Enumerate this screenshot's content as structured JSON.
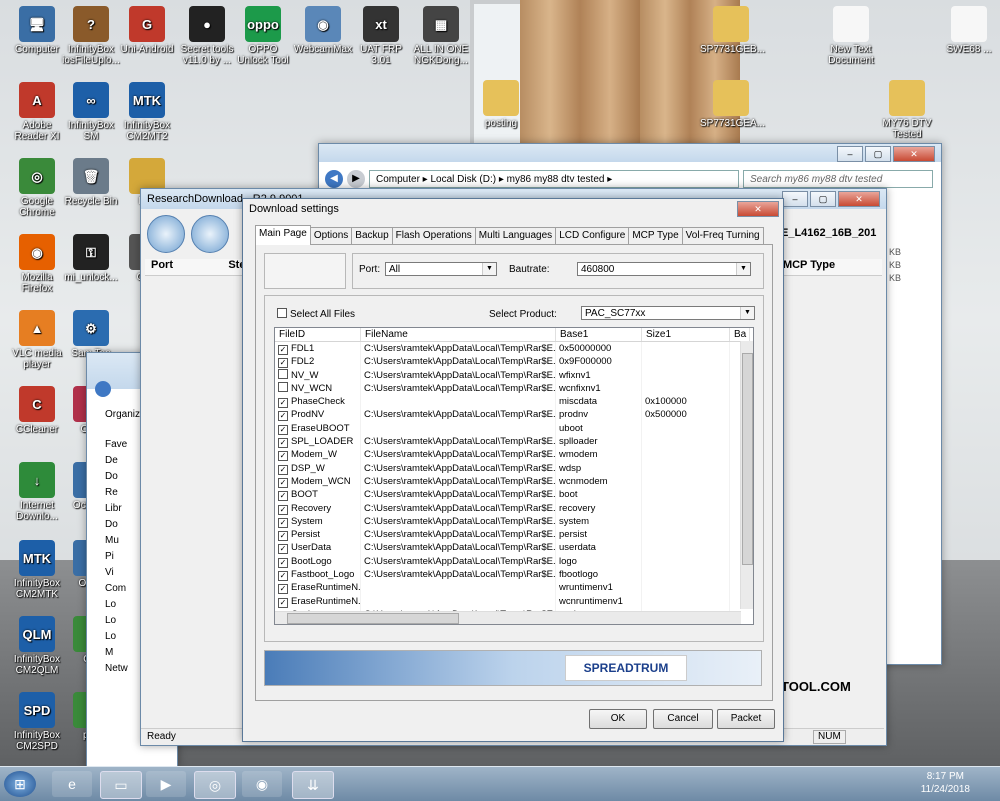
{
  "desktop": {
    "icons": [
      {
        "label": "Computer",
        "color": "#3a6ea5",
        "glyph": "🖥"
      },
      {
        "label": "InfinityBox iosFileUplo...",
        "color": "#8a5a2a",
        "glyph": "?"
      },
      {
        "label": "Uni-Android",
        "color": "#c0392b",
        "glyph": "G"
      },
      {
        "label": "Secret tools v11.0 by ...",
        "color": "#222",
        "glyph": "●"
      },
      {
        "label": "OPPO Unlock Tool",
        "color": "#1c9a4a",
        "glyph": "oppo"
      },
      {
        "label": "WebcamMax",
        "color": "#5a87b8",
        "glyph": "◉"
      },
      {
        "label": "UAT FRP 3.01",
        "color": "#333",
        "glyph": "xt"
      },
      {
        "label": "ALL IN ONE NGKDong...",
        "color": "#444",
        "glyph": "▦"
      },
      {
        "label": "Adobe Reader XI",
        "color": "#c0392b",
        "glyph": "A"
      },
      {
        "label": "InfinityBox SM",
        "color": "#1d5fa8",
        "glyph": "∞"
      },
      {
        "label": "InfinityBox CM2MT2",
        "color": "#1d5fa8",
        "glyph": "MTK"
      },
      {
        "label": "Google Chrome",
        "color": "#3a8a3a",
        "glyph": "◎"
      },
      {
        "label": "Recycle Bin",
        "color": "#6b7b8a",
        "glyph": "🗑"
      },
      {
        "label": "Pos",
        "color": "#d4a83a",
        "glyph": ""
      },
      {
        "label": "Mozilla Firefox",
        "color": "#e66000",
        "glyph": "◉"
      },
      {
        "label": "mi_unlock...",
        "color": "#222",
        "glyph": "⚿"
      },
      {
        "label": "GRT",
        "color": "#555",
        "glyph": ""
      },
      {
        "label": "VLC media player",
        "color": "#e67e22",
        "glyph": "▲"
      },
      {
        "label": "Sam Too",
        "color": "#2b6cb0",
        "glyph": "⚙"
      },
      {
        "label": "CCleaner",
        "color": "#c0392b",
        "glyph": "C"
      },
      {
        "label": "Octo",
        "color": "#b0304a",
        "glyph": "✓"
      },
      {
        "label": "Internet Downlo...",
        "color": "#2e8b3a",
        "glyph": "↓"
      },
      {
        "label": "Octo Sa",
        "color": "#3a6ea5",
        "glyph": ""
      },
      {
        "label": "InfinityBox CM2MTK",
        "color": "#1d5fa8",
        "glyph": "MTK"
      },
      {
        "label": "Oct S",
        "color": "#3a6ea5",
        "glyph": ""
      },
      {
        "label": "InfinityBox CM2QLM",
        "color": "#1d5fa8",
        "glyph": "QLM"
      },
      {
        "label": "Oct",
        "color": "#3a8a3a",
        "glyph": ""
      },
      {
        "label": "InfinityBox CM2SPD",
        "color": "#1d5fa8",
        "glyph": "SPD"
      },
      {
        "label": "pTo",
        "color": "#3a8a3a",
        "glyph": ""
      },
      {
        "label": "SP7731GEB...",
        "color": "#e6c15a",
        "glyph": ""
      },
      {
        "label": "New Text Document",
        "color": "#f7f7f7",
        "glyph": ""
      },
      {
        "label": "SWE68 ...",
        "color": "#f7f7f7",
        "glyph": ""
      },
      {
        "label": "posting",
        "color": "#e6c15a",
        "glyph": ""
      },
      {
        "label": "SP7731GEA...",
        "color": "#e6c15a",
        "glyph": ""
      },
      {
        "label": "MY76 DTV Tested",
        "color": "#e6c15a",
        "glyph": ""
      }
    ]
  },
  "explorer": {
    "path": [
      "Computer",
      "Local Disk (D:)",
      "my86 my88 dtv tested"
    ],
    "search_placeholder": "Search my86 my88 dtv tested",
    "sizes": [
      "KB",
      "KB",
      "KB"
    ]
  },
  "research": {
    "title": "ResearchDownload",
    "version": "R2.9.9001",
    "columns": [
      "Port",
      "Step",
      "MCP Type"
    ],
    "status": "Ready",
    "file_label": "E_L4162_16B_201",
    "num": "NUM",
    "tool_text": "TOOL.COM"
  },
  "explorer_left": {
    "organize": "Organize",
    "items": [
      "Fave",
      "De",
      "Do",
      "Re",
      "Libr",
      "Do",
      "Mu",
      "Pi",
      "Vi",
      "Com",
      "Lo",
      "Lo",
      "Lo",
      "M",
      "Netw"
    ]
  },
  "dialog": {
    "title": "Download settings",
    "tabs": [
      "Main Page",
      "Options",
      "Backup",
      "Flash Operations",
      "Multi Languages",
      "LCD Configure",
      "MCP Type",
      "Vol-Freq Turning"
    ],
    "port_label": "Port:",
    "port_value": "All",
    "baud_label": "Bautrate:",
    "baud_value": "460800",
    "select_all": "Select All Files",
    "product_label": "Select Product:",
    "product_value": "PAC_SC77xx",
    "columns": [
      "FileID",
      "FileName",
      "Base1",
      "Size1",
      "Ba"
    ],
    "rows": [
      {
        "id": "FDL1",
        "checked": true,
        "name": "C:\\Users\\ramtek\\AppData\\Local\\Temp\\Rar$E...",
        "base": "0x50000000",
        "size": ""
      },
      {
        "id": "FDL2",
        "checked": true,
        "name": "C:\\Users\\ramtek\\AppData\\Local\\Temp\\Rar$E...",
        "base": "0x9F000000",
        "size": ""
      },
      {
        "id": "NV_W",
        "checked": false,
        "name": "C:\\Users\\ramtek\\AppData\\Local\\Temp\\Rar$E...",
        "base": "wfixnv1",
        "size": ""
      },
      {
        "id": "NV_WCN",
        "checked": false,
        "name": "C:\\Users\\ramtek\\AppData\\Local\\Temp\\Rar$E...",
        "base": "wcnfixnv1",
        "size": ""
      },
      {
        "id": "PhaseCheck",
        "checked": true,
        "name": "",
        "base": "miscdata",
        "size": "0x100000"
      },
      {
        "id": "ProdNV",
        "checked": true,
        "name": "C:\\Users\\ramtek\\AppData\\Local\\Temp\\Rar$E...",
        "base": "prodnv",
        "size": "0x500000"
      },
      {
        "id": "EraseUBOOT",
        "checked": true,
        "name": "",
        "base": "uboot",
        "size": ""
      },
      {
        "id": "SPL_LOADER",
        "checked": true,
        "name": "C:\\Users\\ramtek\\AppData\\Local\\Temp\\Rar$E...",
        "base": "splloader",
        "size": ""
      },
      {
        "id": "Modem_W",
        "checked": true,
        "name": "C:\\Users\\ramtek\\AppData\\Local\\Temp\\Rar$E...",
        "base": "wmodem",
        "size": ""
      },
      {
        "id": "DSP_W",
        "checked": true,
        "name": "C:\\Users\\ramtek\\AppData\\Local\\Temp\\Rar$E...",
        "base": "wdsp",
        "size": ""
      },
      {
        "id": "Modem_WCN",
        "checked": true,
        "name": "C:\\Users\\ramtek\\AppData\\Local\\Temp\\Rar$E...",
        "base": "wcnmodem",
        "size": ""
      },
      {
        "id": "BOOT",
        "checked": true,
        "name": "C:\\Users\\ramtek\\AppData\\Local\\Temp\\Rar$E...",
        "base": "boot",
        "size": ""
      },
      {
        "id": "Recovery",
        "checked": true,
        "name": "C:\\Users\\ramtek\\AppData\\Local\\Temp\\Rar$E...",
        "base": "recovery",
        "size": ""
      },
      {
        "id": "System",
        "checked": true,
        "name": "C:\\Users\\ramtek\\AppData\\Local\\Temp\\Rar$E...",
        "base": "system",
        "size": ""
      },
      {
        "id": "Persist",
        "checked": true,
        "name": "C:\\Users\\ramtek\\AppData\\Local\\Temp\\Rar$E...",
        "base": "persist",
        "size": ""
      },
      {
        "id": "UserData",
        "checked": true,
        "name": "C:\\Users\\ramtek\\AppData\\Local\\Temp\\Rar$E...",
        "base": "userdata",
        "size": ""
      },
      {
        "id": "BootLogo",
        "checked": true,
        "name": "C:\\Users\\ramtek\\AppData\\Local\\Temp\\Rar$E...",
        "base": "logo",
        "size": ""
      },
      {
        "id": "Fastboot_Logo",
        "checked": true,
        "name": "C:\\Users\\ramtek\\AppData\\Local\\Temp\\Rar$E...",
        "base": "fbootlogo",
        "size": ""
      },
      {
        "id": "EraseRuntimeN...",
        "checked": true,
        "name": "",
        "base": "wruntimenv1",
        "size": ""
      },
      {
        "id": "EraseRuntimeN...",
        "checked": true,
        "name": "",
        "base": "wcnruntimenv1",
        "size": ""
      },
      {
        "id": "Cache",
        "checked": true,
        "name": "C:\\Users\\ramtek\\AppData\\Local\\Temp\\Rar$E...",
        "base": "cache",
        "size": ""
      }
    ],
    "brand": "SPREADTRUM",
    "ok": "OK",
    "cancel": "Cancel",
    "packet": "Packet"
  },
  "taskbar": {
    "apps": [
      "start",
      "ie",
      "explorer",
      "media",
      "chrome",
      "firefox",
      "research"
    ],
    "time": "8:17 PM",
    "date": "11/24/2018"
  }
}
